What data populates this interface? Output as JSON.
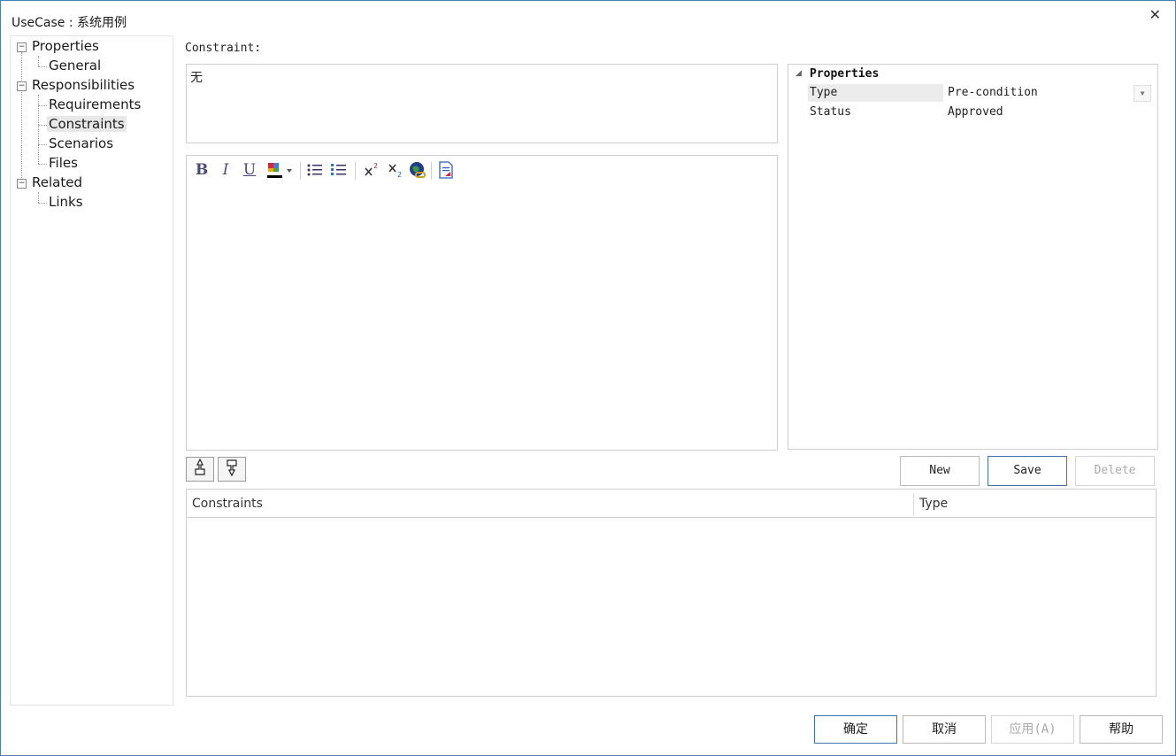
{
  "window": {
    "title": "UseCase : 系统用例",
    "close_glyph": "✕"
  },
  "tree": {
    "items": [
      {
        "label": "Properties",
        "toggle": "−"
      },
      {
        "label": "General"
      },
      {
        "label": "Responsibilities",
        "toggle": "−"
      },
      {
        "label": "Requirements"
      },
      {
        "label": "Constraints",
        "selected": true
      },
      {
        "label": "Scenarios"
      },
      {
        "label": "Files"
      },
      {
        "label": "Related",
        "toggle": "−"
      },
      {
        "label": "Links"
      }
    ]
  },
  "constraint": {
    "label": "Constraint:",
    "value": "无"
  },
  "editor_toolbar": {
    "bold": "B",
    "italic": "I",
    "underline": "U",
    "font_color_icon": "font-color-icon",
    "bullets_icon": "bulleted-list-icon",
    "numbers_icon": "numbered-list-icon",
    "superscript_icon": "superscript-icon",
    "subscript_icon": "subscript-icon",
    "hyperlink_icon": "hyperlink-globe-icon",
    "document_icon": "document-icon"
  },
  "properties": {
    "header": "Properties",
    "rows": [
      {
        "key": "Type",
        "value": "Pre-condition"
      },
      {
        "key": "Status",
        "value": "Approved"
      }
    ]
  },
  "actions": {
    "new": "New",
    "save": "Save",
    "delete": "Delete"
  },
  "grid": {
    "columns": [
      "Constraints",
      "Type"
    ]
  },
  "dialog_buttons": {
    "ok": "确定",
    "cancel": "取消",
    "apply": "应用(A)",
    "help": "帮助"
  }
}
